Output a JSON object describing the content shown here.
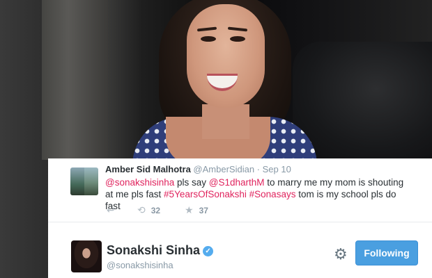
{
  "tweet": {
    "author_name": "Amber Sid Malhotra",
    "author_handle": "@AmberSidian",
    "separator": " · ",
    "date": "Sep 10",
    "body_parts": [
      {
        "text": "@sonakshisinha",
        "highlight": true
      },
      {
        "text": " pls say ",
        "highlight": false
      },
      {
        "text": "@S1dharthM",
        "highlight": true
      },
      {
        "text": " to marry me my mom is shouting at me pls fast ",
        "highlight": false
      },
      {
        "text": "#5YearsOfSonakshi",
        "highlight": true
      },
      {
        "text": " ",
        "highlight": false
      },
      {
        "text": "#Sonasays",
        "highlight": true
      },
      {
        "text": " tom is my school pls do fast",
        "highlight": false
      }
    ],
    "actions": {
      "reply_icon": "reply-icon",
      "retweet_icon": "retweet-icon",
      "retweet_count": "32",
      "favorite_icon": "star-icon",
      "favorite_count": "37"
    }
  },
  "profile": {
    "name": "Sonakshi Sinha",
    "handle": "@sonakshisinha",
    "verified_icon": "verified-badge-icon",
    "settings_icon": "gear-icon",
    "follow_button_label": "Following"
  },
  "colors": {
    "highlight": "#e0245e",
    "follow_button": "#4a9fe0",
    "verified": "#55acee",
    "meta_text": "#8899a6"
  }
}
